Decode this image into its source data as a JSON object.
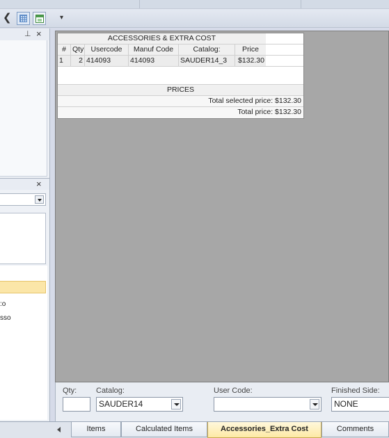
{
  "toolbar": {
    "chevron": "❮",
    "overflow": "▾"
  },
  "left_dock": {
    "pin_glyph": "⊥",
    "close_glyph": "×",
    "items": [
      ":o",
      "sso"
    ]
  },
  "accessories_table": {
    "title": "ACCESSORIES & EXTRA COST",
    "columns": [
      "#",
      "Qty:",
      "Usercode",
      "Manuf Code",
      "Catalog:",
      "Price"
    ],
    "rows": [
      {
        "num": "1",
        "qty": "2",
        "usercode": "414093",
        "manuf_code": "414093",
        "catalog": "SAUDER14_3",
        "price": "$132.30"
      }
    ]
  },
  "prices": {
    "title": "PRICES",
    "total_selected": "Total selected price: $132.30",
    "total": "Total price: $132.30"
  },
  "form": {
    "qty_label": "Qty:",
    "qty_value": "",
    "catalog_label": "Catalog:",
    "catalog_value": "SAUDER14",
    "usercode_label": "User Code:",
    "usercode_value": "",
    "finished_side_label": "Finished Side:",
    "finished_side_value": "NONE"
  },
  "tabs": [
    {
      "label": "Items",
      "active": false
    },
    {
      "label": "Calculated Items",
      "active": false
    },
    {
      "label": "Accessories_Extra Cost",
      "active": true
    },
    {
      "label": "Comments",
      "active": false
    }
  ],
  "colors": {
    "workspace": "#a7a7a7",
    "active_tab": "#fde9a5",
    "selected_row": "#fbe6a8"
  }
}
